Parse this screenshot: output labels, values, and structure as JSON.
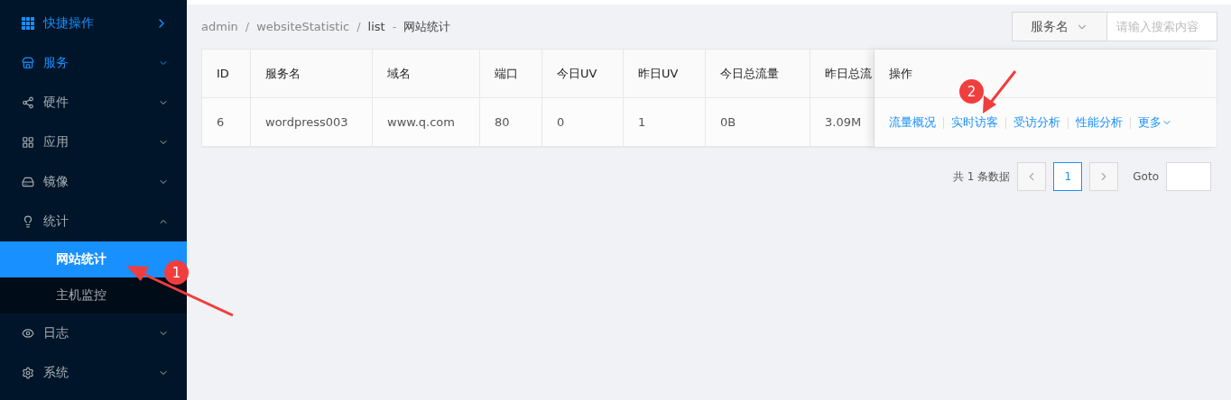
{
  "sidebar": {
    "items": [
      {
        "label": "快捷操作",
        "kind": "link",
        "highlighted": true
      },
      {
        "label": "服务",
        "kind": "submenu",
        "highlighted": true,
        "expanded": false
      },
      {
        "label": "硬件",
        "kind": "submenu",
        "highlighted": false,
        "expanded": false
      },
      {
        "label": "应用",
        "kind": "submenu",
        "highlighted": false,
        "expanded": false
      },
      {
        "label": "镜像",
        "kind": "submenu",
        "highlighted": false,
        "expanded": false
      },
      {
        "label": "统计",
        "kind": "submenu",
        "highlighted": false,
        "expanded": true,
        "children": [
          {
            "label": "网站统计",
            "selected": true
          },
          {
            "label": "主机监控",
            "selected": false
          }
        ]
      },
      {
        "label": "日志",
        "kind": "submenu",
        "highlighted": false,
        "expanded": false
      },
      {
        "label": "系统",
        "kind": "submenu",
        "highlighted": false,
        "expanded": false
      }
    ]
  },
  "breadcrumb": [
    {
      "label": "admin",
      "kind": "link"
    },
    {
      "label": "/",
      "kind": "separator"
    },
    {
      "label": "websiteStatistic",
      "kind": "link"
    },
    {
      "label": "/",
      "kind": "separator"
    },
    {
      "label": "list",
      "kind": "current"
    },
    {
      "label": "-",
      "kind": "separator"
    },
    {
      "label": "网站统计",
      "kind": "title"
    }
  ],
  "search": {
    "field": "服务名",
    "placeholder": "请输入搜索内容"
  },
  "table": {
    "columns": [
      "ID",
      "服务名",
      "域名",
      "端口",
      "今日UV",
      "昨日UV",
      "今日总流量",
      "昨日总流"
    ],
    "actions_header": "操作",
    "rows": [
      {
        "cells": [
          "6",
          "wordpress003",
          "www.q.com",
          "80",
          "0",
          "1",
          "0B",
          "3.09M"
        ],
        "actions": [
          {
            "label": "流量概况",
            "kind": "link"
          },
          {
            "label": "实时访客",
            "kind": "link"
          },
          {
            "label": "受访分析",
            "kind": "link"
          },
          {
            "label": "性能分析",
            "kind": "link"
          },
          {
            "label": "更多",
            "kind": "dropdown"
          }
        ]
      }
    ]
  },
  "pagination": {
    "total": "共 1 条数据",
    "pages": [
      {
        "label": "1",
        "selected": true
      }
    ],
    "goto": "Goto"
  },
  "annotations": [
    {
      "label": "1"
    },
    {
      "label": "2"
    }
  ]
}
